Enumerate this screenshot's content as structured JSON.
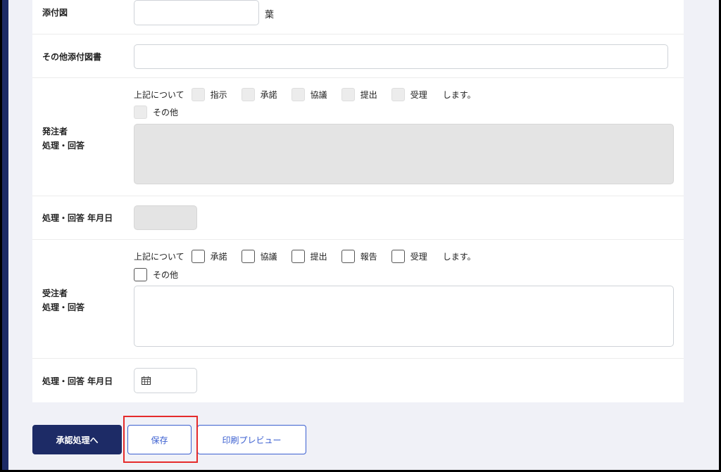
{
  "form": {
    "attachment": {
      "label": "添付図",
      "unit": "葉"
    },
    "other_attachment": {
      "label": "その他添付図書"
    },
    "orderer_response": {
      "label_line1": "発注者",
      "label_line2": "処理・回答",
      "prefix": "上記について",
      "options": [
        "指示",
        "承諾",
        "協議",
        "提出",
        "受理"
      ],
      "suffix": "します。",
      "other": "その他"
    },
    "orderer_date": {
      "label": "処理・回答 年月日"
    },
    "contractor_response": {
      "label_line1": "受注者",
      "label_line2": "処理・回答",
      "prefix": "上記について",
      "options": [
        "承諾",
        "協議",
        "提出",
        "報告",
        "受理"
      ],
      "suffix": "します。",
      "other": "その他"
    },
    "contractor_date": {
      "label": "処理・回答 年月日",
      "icon": "calendar-icon"
    }
  },
  "actions": {
    "approve": "承認処理へ",
    "save": "保存",
    "preview": "印刷プレビュー"
  },
  "colors": {
    "primary": "#1d2b66",
    "outline": "#3b5fd0",
    "highlight": "#e52b2b",
    "disabled": "#e4e4e4"
  }
}
